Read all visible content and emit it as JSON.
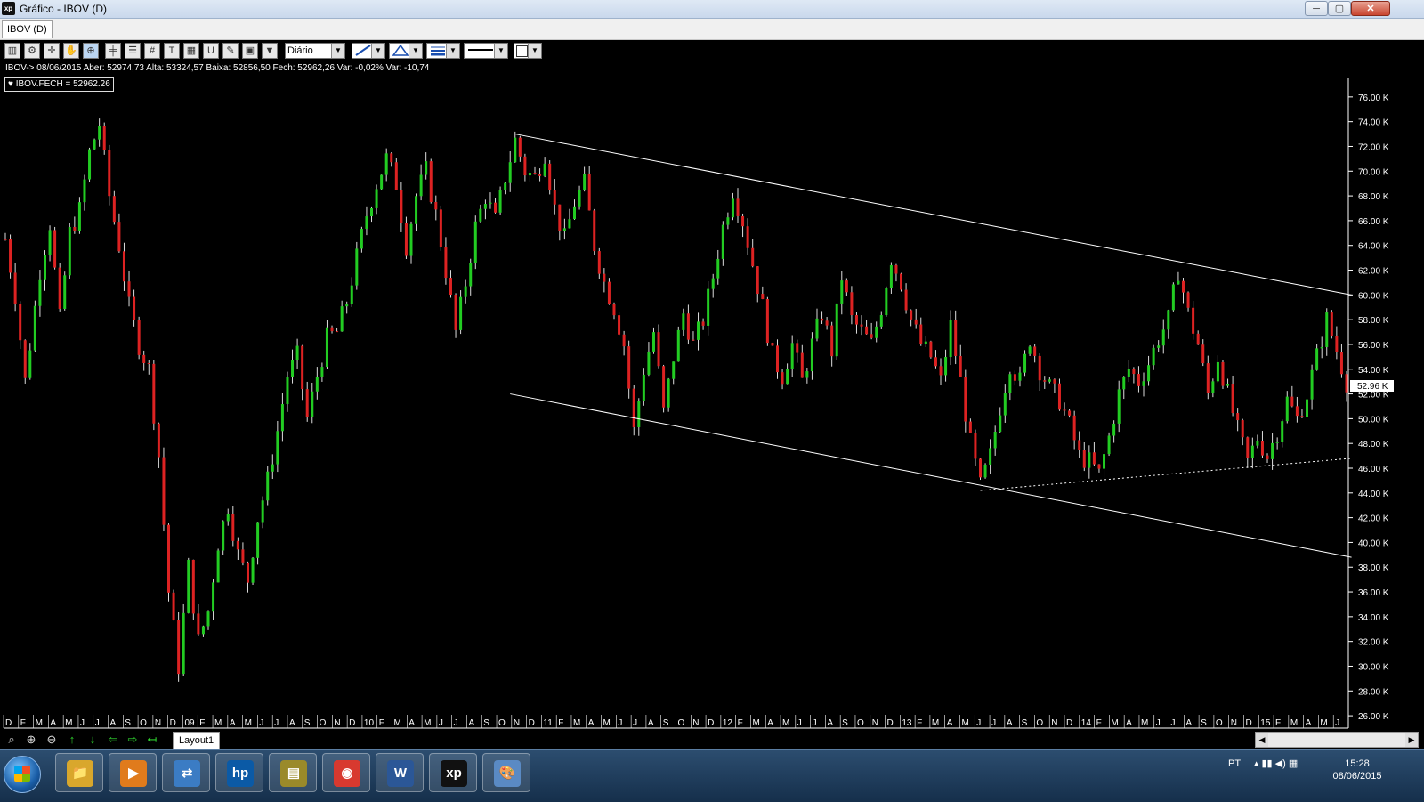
{
  "window": {
    "title": "Gráfico - IBOV (D)",
    "app_icon_text": "xp",
    "buttons": {
      "minimize": "─",
      "restore": "▢",
      "close": "✕"
    }
  },
  "tabs": [
    {
      "label": "IBOV (D)"
    }
  ],
  "toolbar": {
    "icons": [
      "chart-type-icon",
      "settings-icon",
      "crosshair-icon",
      "hand-icon",
      "zoom-tool-icon",
      "horizontal-line-icon",
      "fibonacci-icon",
      "grid-icon",
      "text-icon",
      "calculator-icon",
      "magnet-icon",
      "eraser-icon",
      "clipboard-icon",
      "filter-icon"
    ],
    "period_value": "Diário",
    "dropdown_arrow": "▼"
  },
  "quote_info": "IBOV-> 08/06/2015 Aber: 52974,73 Alta: 53324,57 Baixa: 52856,50 Fech: 52962,26 Var: -0,02% Var: -10,74",
  "legend_label": "♥ IBOV.FECH = 52962.26",
  "last_price_label": "52.96 K",
  "colors": {
    "background": "#000000",
    "candle_up": "#22cc22",
    "candle_down": "#dd2222",
    "trendline": "#ffffff",
    "axis_text": "#ffffff"
  },
  "chart_data": {
    "type": "candlestick",
    "symbol": "IBOV",
    "period": "Diário",
    "y_ticks": [
      "76.00 K",
      "74.00 K",
      "72.00 K",
      "70.00 K",
      "68.00 K",
      "66.00 K",
      "64.00 K",
      "62.00 K",
      "60.00 K",
      "58.00 K",
      "56.00 K",
      "54.00 K",
      "52.00 K",
      "50.00 K",
      "48.00 K",
      "46.00 K",
      "44.00 K",
      "42.00 K",
      "40.00 K",
      "38.00 K",
      "36.00 K",
      "34.00 K",
      "32.00 K",
      "30.00 K",
      "28.00 K",
      "26.00 K"
    ],
    "ylim": [
      25000,
      77500
    ],
    "x_ticks": [
      "D",
      "F",
      "M",
      "A",
      "M",
      "J",
      "J",
      "A",
      "S",
      "O",
      "N",
      "D",
      "09",
      "F",
      "M",
      "A",
      "M",
      "J",
      "J",
      "A",
      "S",
      "O",
      "N",
      "D",
      "10",
      "F",
      "M",
      "A",
      "M",
      "J",
      "J",
      "A",
      "S",
      "O",
      "N",
      "D",
      "11",
      "F",
      "M",
      "A",
      "M",
      "J",
      "J",
      "A",
      "S",
      "O",
      "N",
      "D",
      "12",
      "F",
      "M",
      "A",
      "M",
      "J",
      "J",
      "A",
      "S",
      "O",
      "N",
      "D",
      "13",
      "F",
      "M",
      "A",
      "M",
      "J",
      "J",
      "A",
      "S",
      "O",
      "N",
      "D",
      "14",
      "F",
      "M",
      "A",
      "M",
      "J",
      "J",
      "A",
      "S",
      "O",
      "N",
      "D",
      "15",
      "F",
      "M",
      "A",
      "M",
      "J"
    ],
    "close_path": [
      [
        0,
        64500
      ],
      [
        2,
        60000
      ],
      [
        4,
        53000
      ],
      [
        7,
        62000
      ],
      [
        9,
        65800
      ],
      [
        11,
        58000
      ],
      [
        13,
        65000
      ],
      [
        15,
        66800
      ],
      [
        17,
        71500
      ],
      [
        19,
        73800
      ],
      [
        21,
        68000
      ],
      [
        23,
        64000
      ],
      [
        25,
        59000
      ],
      [
        27,
        56000
      ],
      [
        29,
        54000
      ],
      [
        31,
        47000
      ],
      [
        33,
        36000
      ],
      [
        35,
        30000
      ],
      [
        37,
        38000
      ],
      [
        39,
        32000
      ],
      [
        41,
        34500
      ],
      [
        43,
        40000
      ],
      [
        45,
        43000
      ],
      [
        47,
        39000
      ],
      [
        49,
        37000
      ],
      [
        51,
        42000
      ],
      [
        53,
        45000
      ],
      [
        55,
        49000
      ],
      [
        57,
        53500
      ],
      [
        59,
        55000
      ],
      [
        61,
        50000
      ],
      [
        63,
        53500
      ],
      [
        65,
        56500
      ],
      [
        67,
        57000
      ],
      [
        69,
        59500
      ],
      [
        71,
        63000
      ],
      [
        73,
        66500
      ],
      [
        75,
        69000
      ],
      [
        77,
        71000
      ],
      [
        79,
        69000
      ],
      [
        81,
        64000
      ],
      [
        83,
        68000
      ],
      [
        85,
        70000
      ],
      [
        87,
        66500
      ],
      [
        89,
        62000
      ],
      [
        91,
        57000
      ],
      [
        93,
        61000
      ],
      [
        95,
        65500
      ],
      [
        97,
        68000
      ],
      [
        99,
        66000
      ],
      [
        101,
        69500
      ],
      [
        103,
        72500
      ],
      [
        105,
        70000
      ],
      [
        107,
        69500
      ],
      [
        109,
        71500
      ],
      [
        111,
        67000
      ],
      [
        113,
        64500
      ],
      [
        115,
        67500
      ],
      [
        117,
        69000
      ],
      [
        119,
        64000
      ],
      [
        121,
        61000
      ],
      [
        123,
        59000
      ],
      [
        125,
        56000
      ],
      [
        127,
        49000
      ],
      [
        129,
        54000
      ],
      [
        131,
        57000
      ],
      [
        133,
        50500
      ],
      [
        135,
        55000
      ],
      [
        137,
        58500
      ],
      [
        139,
        56000
      ],
      [
        141,
        58000
      ],
      [
        143,
        61500
      ],
      [
        145,
        65500
      ],
      [
        147,
        68500
      ],
      [
        149,
        66000
      ],
      [
        151,
        62500
      ],
      [
        153,
        59000
      ],
      [
        155,
        55000
      ],
      [
        157,
        53500
      ],
      [
        159,
        56000
      ],
      [
        161,
        53000
      ],
      [
        163,
        56000
      ],
      [
        165,
        58500
      ],
      [
        167,
        55500
      ],
      [
        169,
        61500
      ],
      [
        171,
        58000
      ],
      [
        173,
        57000
      ],
      [
        175,
        56000
      ],
      [
        177,
        59000
      ],
      [
        179,
        63000
      ],
      [
        181,
        61000
      ],
      [
        183,
        58000
      ],
      [
        185,
        56000
      ],
      [
        187,
        55000
      ],
      [
        189,
        53000
      ],
      [
        191,
        57500
      ],
      [
        193,
        53000
      ],
      [
        195,
        48000
      ],
      [
        197,
        44500
      ],
      [
        199,
        47000
      ],
      [
        201,
        51000
      ],
      [
        203,
        54500
      ],
      [
        205,
        53000
      ],
      [
        207,
        56500
      ],
      [
        209,
        54000
      ],
      [
        211,
        52500
      ],
      [
        213,
        51500
      ],
      [
        215,
        49500
      ],
      [
        217,
        47000
      ],
      [
        219,
        46500
      ],
      [
        221,
        45500
      ],
      [
        223,
        48500
      ],
      [
        225,
        52000
      ],
      [
        227,
        54000
      ],
      [
        229,
        53000
      ],
      [
        231,
        54500
      ],
      [
        233,
        56500
      ],
      [
        235,
        58000
      ],
      [
        237,
        62000
      ],
      [
        239,
        58500
      ],
      [
        241,
        56000
      ],
      [
        243,
        52000
      ],
      [
        245,
        55000
      ],
      [
        247,
        52000
      ],
      [
        249,
        49000
      ],
      [
        251,
        46500
      ],
      [
        253,
        48500
      ],
      [
        255,
        47000
      ],
      [
        257,
        49000
      ],
      [
        259,
        51500
      ],
      [
        261,
        50000
      ],
      [
        263,
        52000
      ],
      [
        265,
        55000
      ],
      [
        267,
        58000
      ],
      [
        269,
        55500
      ],
      [
        271,
        53000
      ]
    ],
    "points_total": 272,
    "trendlines": [
      {
        "style": "solid",
        "from": [
          103,
          73000
        ],
        "to": [
          272,
          60000
        ]
      },
      {
        "style": "solid",
        "from": [
          102,
          52000
        ],
        "to": [
          272,
          38800
        ]
      },
      {
        "style": "dotted",
        "from": [
          197,
          44200
        ],
        "to": [
          272,
          46800
        ]
      }
    ]
  },
  "bottom": {
    "nav_icons": [
      "zoom-icon",
      "zoom-in-icon",
      "zoom-out-icon",
      "up-arrow-icon",
      "down-arrow-icon",
      "left-arrow-icon",
      "right-arrow-icon",
      "back-icon"
    ],
    "nav_glyphs": [
      "⌕",
      "⊕",
      "⊖",
      "↑",
      "↓",
      "⇦",
      "⇨",
      "↤"
    ],
    "layout_tab": "Layout1",
    "scroll_left": "◀",
    "scroll_right": "▶"
  },
  "taskbar": {
    "apps": [
      {
        "name": "explorer",
        "text": "📁",
        "color": "#d9a72c"
      },
      {
        "name": "media-player",
        "text": "▶",
        "color": "#e07b1c"
      },
      {
        "name": "network",
        "text": "⇄",
        "color": "#3b7cc4"
      },
      {
        "name": "hp",
        "text": "hp",
        "color": "#0b5aa6"
      },
      {
        "name": "scanner",
        "text": "▤",
        "color": "#9a8a2a"
      },
      {
        "name": "chrome",
        "text": "◉",
        "color": "#d8392f"
      },
      {
        "name": "word",
        "text": "W",
        "color": "#2b5797"
      },
      {
        "name": "xp",
        "text": "xp",
        "color": "#111111"
      },
      {
        "name": "paint",
        "text": "🎨",
        "color": "#5a8ac4"
      }
    ],
    "language": "PT",
    "tray_icons": "▴  ▮▮  ◀)  ▦",
    "time": "15:28",
    "date": "08/06/2015"
  }
}
